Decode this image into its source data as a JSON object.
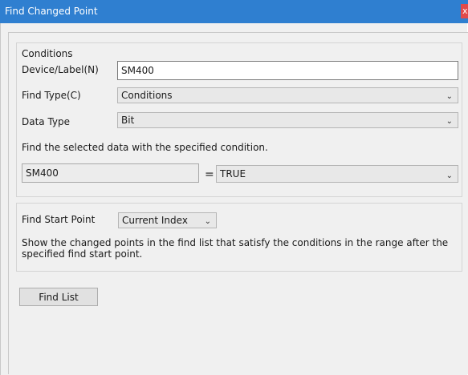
{
  "window": {
    "title": "Find Changed Point",
    "close_glyph": "x"
  },
  "conditions": {
    "heading": "Conditions",
    "device_label": "Device/Label(N)",
    "device_value": "SM400",
    "find_type_label": "Find Type(C)",
    "find_type_value": "Conditions",
    "data_type_label": "Data Type",
    "data_type_value": "Bit",
    "instruction": "Find the selected data with the specified condition.",
    "condition_device": "SM400",
    "operator": "=",
    "condition_value": "TRUE"
  },
  "start_point": {
    "label": "Find Start Point",
    "value": "Current Index",
    "description": "Show the changed points in the find list that satisfy the conditions in the range after the specified find start point."
  },
  "actions": {
    "find_list_label": "Find List"
  },
  "icons": {
    "dropdown": "chevron-down-icon",
    "close": "close-icon"
  },
  "colors": {
    "titlebar": "#2f7fd0",
    "close": "#e14a4a",
    "window_bg": "#f0f0f0"
  }
}
